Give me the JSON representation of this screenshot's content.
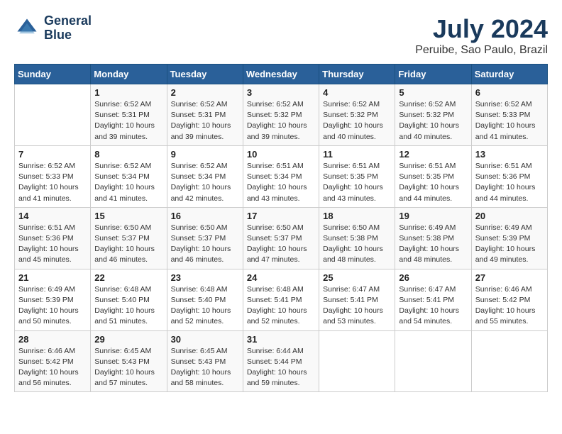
{
  "header": {
    "logo_line1": "General",
    "logo_line2": "Blue",
    "month_title": "July 2024",
    "subtitle": "Peruibe, Sao Paulo, Brazil"
  },
  "days_of_week": [
    "Sunday",
    "Monday",
    "Tuesday",
    "Wednesday",
    "Thursday",
    "Friday",
    "Saturday"
  ],
  "weeks": [
    [
      {
        "day": "",
        "info": ""
      },
      {
        "day": "1",
        "info": "Sunrise: 6:52 AM\nSunset: 5:31 PM\nDaylight: 10 hours\nand 39 minutes."
      },
      {
        "day": "2",
        "info": "Sunrise: 6:52 AM\nSunset: 5:31 PM\nDaylight: 10 hours\nand 39 minutes."
      },
      {
        "day": "3",
        "info": "Sunrise: 6:52 AM\nSunset: 5:32 PM\nDaylight: 10 hours\nand 39 minutes."
      },
      {
        "day": "4",
        "info": "Sunrise: 6:52 AM\nSunset: 5:32 PM\nDaylight: 10 hours\nand 40 minutes."
      },
      {
        "day": "5",
        "info": "Sunrise: 6:52 AM\nSunset: 5:32 PM\nDaylight: 10 hours\nand 40 minutes."
      },
      {
        "day": "6",
        "info": "Sunrise: 6:52 AM\nSunset: 5:33 PM\nDaylight: 10 hours\nand 41 minutes."
      }
    ],
    [
      {
        "day": "7",
        "info": "Sunrise: 6:52 AM\nSunset: 5:33 PM\nDaylight: 10 hours\nand 41 minutes."
      },
      {
        "day": "8",
        "info": "Sunrise: 6:52 AM\nSunset: 5:34 PM\nDaylight: 10 hours\nand 41 minutes."
      },
      {
        "day": "9",
        "info": "Sunrise: 6:52 AM\nSunset: 5:34 PM\nDaylight: 10 hours\nand 42 minutes."
      },
      {
        "day": "10",
        "info": "Sunrise: 6:51 AM\nSunset: 5:34 PM\nDaylight: 10 hours\nand 43 minutes."
      },
      {
        "day": "11",
        "info": "Sunrise: 6:51 AM\nSunset: 5:35 PM\nDaylight: 10 hours\nand 43 minutes."
      },
      {
        "day": "12",
        "info": "Sunrise: 6:51 AM\nSunset: 5:35 PM\nDaylight: 10 hours\nand 44 minutes."
      },
      {
        "day": "13",
        "info": "Sunrise: 6:51 AM\nSunset: 5:36 PM\nDaylight: 10 hours\nand 44 minutes."
      }
    ],
    [
      {
        "day": "14",
        "info": "Sunrise: 6:51 AM\nSunset: 5:36 PM\nDaylight: 10 hours\nand 45 minutes."
      },
      {
        "day": "15",
        "info": "Sunrise: 6:50 AM\nSunset: 5:37 PM\nDaylight: 10 hours\nand 46 minutes."
      },
      {
        "day": "16",
        "info": "Sunrise: 6:50 AM\nSunset: 5:37 PM\nDaylight: 10 hours\nand 46 minutes."
      },
      {
        "day": "17",
        "info": "Sunrise: 6:50 AM\nSunset: 5:37 PM\nDaylight: 10 hours\nand 47 minutes."
      },
      {
        "day": "18",
        "info": "Sunrise: 6:50 AM\nSunset: 5:38 PM\nDaylight: 10 hours\nand 48 minutes."
      },
      {
        "day": "19",
        "info": "Sunrise: 6:49 AM\nSunset: 5:38 PM\nDaylight: 10 hours\nand 48 minutes."
      },
      {
        "day": "20",
        "info": "Sunrise: 6:49 AM\nSunset: 5:39 PM\nDaylight: 10 hours\nand 49 minutes."
      }
    ],
    [
      {
        "day": "21",
        "info": "Sunrise: 6:49 AM\nSunset: 5:39 PM\nDaylight: 10 hours\nand 50 minutes."
      },
      {
        "day": "22",
        "info": "Sunrise: 6:48 AM\nSunset: 5:40 PM\nDaylight: 10 hours\nand 51 minutes."
      },
      {
        "day": "23",
        "info": "Sunrise: 6:48 AM\nSunset: 5:40 PM\nDaylight: 10 hours\nand 52 minutes."
      },
      {
        "day": "24",
        "info": "Sunrise: 6:48 AM\nSunset: 5:41 PM\nDaylight: 10 hours\nand 52 minutes."
      },
      {
        "day": "25",
        "info": "Sunrise: 6:47 AM\nSunset: 5:41 PM\nDaylight: 10 hours\nand 53 minutes."
      },
      {
        "day": "26",
        "info": "Sunrise: 6:47 AM\nSunset: 5:41 PM\nDaylight: 10 hours\nand 54 minutes."
      },
      {
        "day": "27",
        "info": "Sunrise: 6:46 AM\nSunset: 5:42 PM\nDaylight: 10 hours\nand 55 minutes."
      }
    ],
    [
      {
        "day": "28",
        "info": "Sunrise: 6:46 AM\nSunset: 5:42 PM\nDaylight: 10 hours\nand 56 minutes."
      },
      {
        "day": "29",
        "info": "Sunrise: 6:45 AM\nSunset: 5:43 PM\nDaylight: 10 hours\nand 57 minutes."
      },
      {
        "day": "30",
        "info": "Sunrise: 6:45 AM\nSunset: 5:43 PM\nDaylight: 10 hours\nand 58 minutes."
      },
      {
        "day": "31",
        "info": "Sunrise: 6:44 AM\nSunset: 5:44 PM\nDaylight: 10 hours\nand 59 minutes."
      },
      {
        "day": "",
        "info": ""
      },
      {
        "day": "",
        "info": ""
      },
      {
        "day": "",
        "info": ""
      }
    ]
  ]
}
